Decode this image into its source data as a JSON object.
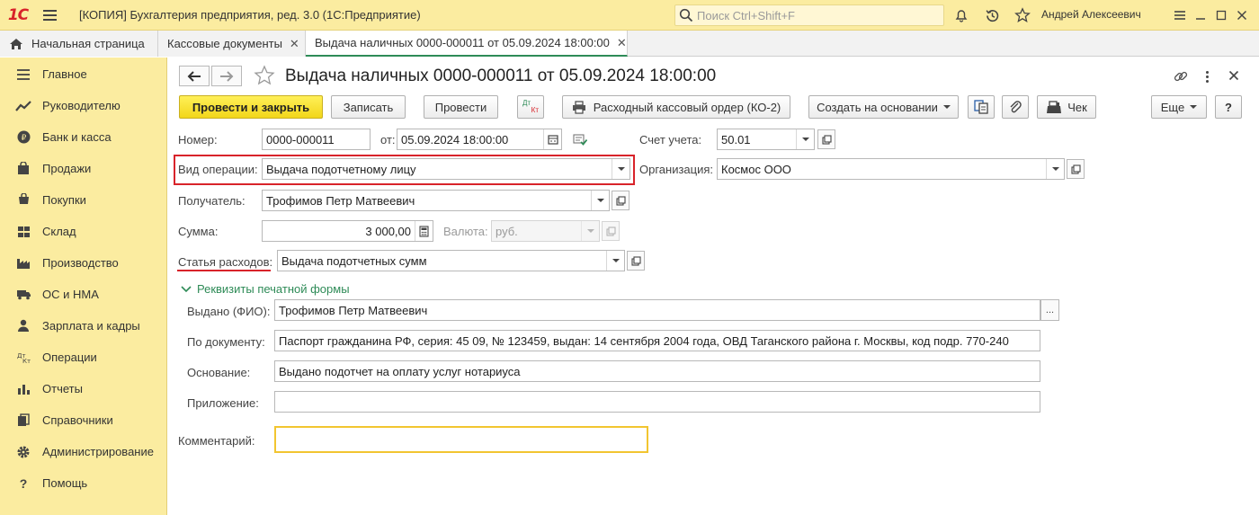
{
  "window": {
    "logo_text": "1С",
    "title": "[КОПИЯ] Бухгалтерия предприятия, ред. 3.0  (1С:Предприятие)",
    "search_placeholder": "Поиск Ctrl+Shift+F",
    "user": "Андрей Алексеевич"
  },
  "tabs": [
    {
      "label": "Начальная страница"
    },
    {
      "label": "Кассовые документы",
      "close": "✕"
    },
    {
      "label": "Выдача наличных 0000-000011 от 05.09.2024 18:00:00",
      "close": "✕",
      "active": true
    }
  ],
  "sidebar": {
    "items": [
      {
        "label": "Главное",
        "icon": "menu-icon"
      },
      {
        "label": "Руководителю",
        "icon": "chart-line-icon"
      },
      {
        "label": "Банк и касса",
        "icon": "coin-icon"
      },
      {
        "label": "Продажи",
        "icon": "bag-icon"
      },
      {
        "label": "Покупки",
        "icon": "cart-icon"
      },
      {
        "label": "Склад",
        "icon": "warehouse-icon"
      },
      {
        "label": "Производство",
        "icon": "factory-icon"
      },
      {
        "label": "ОС и НМА",
        "icon": "truck-icon"
      },
      {
        "label": "Зарплата и кадры",
        "icon": "person-icon"
      },
      {
        "label": "Операции",
        "icon": "dt-kt-icon"
      },
      {
        "label": "Отчеты",
        "icon": "bar-chart-icon"
      },
      {
        "label": "Справочники",
        "icon": "books-icon"
      },
      {
        "label": "Администрирование",
        "icon": "gear-icon"
      },
      {
        "label": "Помощь",
        "icon": "question-icon"
      }
    ]
  },
  "document": {
    "title": "Выдача наличных 0000-000011 от 05.09.2024 18:00:00"
  },
  "toolbar": {
    "post_close": "Провести и закрыть",
    "save": "Записать",
    "post": "Провести",
    "dtkt_top": "Дт",
    "dtkt_bottom": "Кт",
    "print_order": "Расходный кассовый ордер (КО-2)",
    "create_based": "Создать на основании",
    "receipt": "Чек",
    "more": "Еще",
    "help": "?"
  },
  "form": {
    "number_label": "Номер:",
    "number_value": "0000-000011",
    "date_label": "от:",
    "date_value": "05.09.2024 18:00:00",
    "account_label": "Счет учета:",
    "account_value": "50.01",
    "operation_label": "Вид операции:",
    "operation_value": "Выдача подотчетному лицу",
    "org_label": "Организация:",
    "org_value": "Космос ООО",
    "recipient_label": "Получатель:",
    "recipient_value": "Трофимов Петр Матвеевич",
    "sum_label": "Сумма:",
    "sum_value": "3 000,00",
    "currency_label": "Валюта:",
    "currency_value": "руб.",
    "expense_label": "Статья расходов:",
    "expense_value": "Выдача подотчетных сумм",
    "print_section": "Реквизиты печатной формы",
    "issued_label": "Выдано (ФИО):",
    "issued_value": "Трофимов Петр Матвеевич",
    "issued_button": "...",
    "doc_label": "По документу:",
    "doc_value": "Паспорт гражданина РФ, серия: 45 09, № 123459, выдан: 14 сентября 2004 года, ОВД Таганского района г. Москвы, код подр. 770-240",
    "basis_label": "Основание:",
    "basis_value": "Выдано подотчет на оплату услуг нотариуса",
    "attachment_label": "Приложение:",
    "attachment_value": "",
    "comment_label": "Комментарий:",
    "comment_value": ""
  },
  "colors": {
    "accent_yellow": "#fbeca0",
    "primary_button": "#f2d61a",
    "highlight_red": "#d8232a",
    "link_green": "#2e8b57",
    "comment_border": "#f2c530"
  }
}
